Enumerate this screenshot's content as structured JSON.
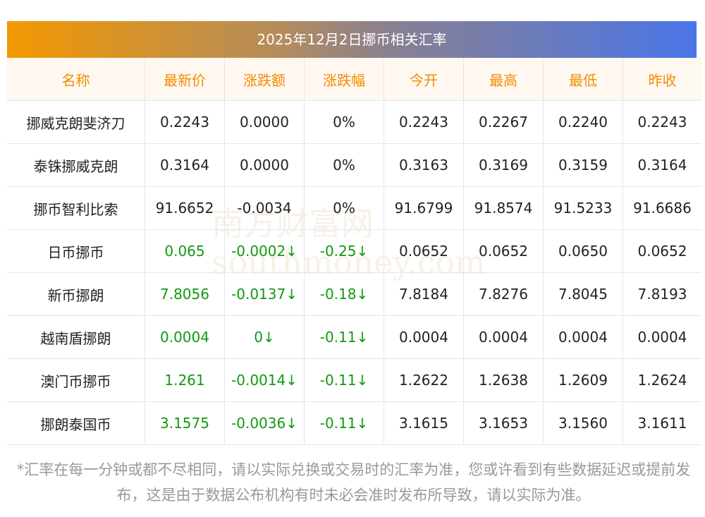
{
  "title": "2025年12月2日挪币相关汇率",
  "headers": [
    "名称",
    "最新价",
    "涨跌额",
    "涨跌幅",
    "今开",
    "最高",
    "最低",
    "昨收"
  ],
  "rows": [
    [
      "挪威克朗斐济刀",
      "0.2243",
      "0.0000",
      "0%",
      "0.2243",
      "0.2267",
      "0.2240",
      "0.2243"
    ],
    [
      "泰铢挪威克朗",
      "0.3164",
      "0.0000",
      "0%",
      "0.3163",
      "0.3169",
      "0.3159",
      "0.3164"
    ],
    [
      "挪币智利比索",
      "91.6652",
      "-0.0034",
      "0%",
      "91.6799",
      "91.8574",
      "91.5233",
      "91.6686"
    ],
    [
      "日币挪币",
      "0.065",
      "-0.0002↓",
      "-0.25↓",
      "0.0652",
      "0.0652",
      "0.0650",
      "0.0652"
    ],
    [
      "新币挪朗",
      "7.8056",
      "-0.0137↓",
      "-0.18↓",
      "7.8184",
      "7.8276",
      "7.8045",
      "7.8193"
    ],
    [
      "越南盾挪朗",
      "0.0004",
      "0↓",
      "-0.11↓",
      "0.0004",
      "0.0004",
      "0.0004",
      "0.0004"
    ],
    [
      "澳门币挪币",
      "1.261",
      "-0.0014↓",
      "-0.11↓",
      "1.2622",
      "1.2638",
      "1.2609",
      "1.2624"
    ],
    [
      "挪朗泰国币",
      "3.1575",
      "-0.0036↓",
      "-0.11↓",
      "3.1615",
      "3.1653",
      "3.1560",
      "3.1611"
    ]
  ],
  "green_rows": [
    3,
    4,
    5,
    6,
    7
  ],
  "watermark": "南方财富网 southmoney.com",
  "note": "*汇率在每一分钟或都不尽相同，请以实际兑换或交易时的汇率为准，您或许看到有些数据延迟或提前发布，这是由于数据公布机构有时未必会准时发布所导致，请以实际为准。",
  "colors": {
    "header_text": "#f08c00",
    "down": "#119911",
    "gradient_start": "#f39800",
    "gradient_end": "#4a76e8"
  }
}
